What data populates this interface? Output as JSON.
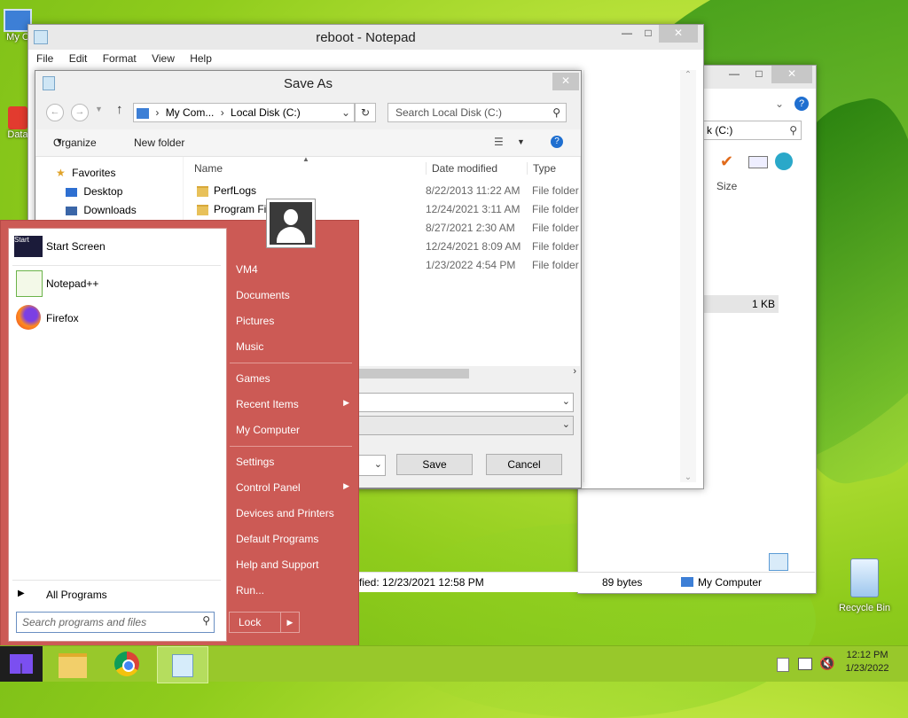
{
  "desktop": {
    "icons": [
      {
        "label": "My C",
        "icon": "computer-icon"
      },
      {
        "label": "Data",
        "icon": "shortcut-icon"
      },
      {
        "label": "Recycle Bin",
        "icon": "recycle-bin-icon"
      }
    ]
  },
  "notepad": {
    "title": "reboot - Notepad",
    "menu": [
      "File",
      "Edit",
      "Format",
      "View",
      "Help"
    ]
  },
  "explorer_bg": {
    "address_tail": "k (C:)",
    "col_size": "Size",
    "size_value": "1 KB",
    "status_modified": "fied: 12/23/2021 12:58 PM",
    "status_size": "89 bytes",
    "status_location": "My Computer"
  },
  "save_as": {
    "title": "Save As",
    "address": {
      "part1": "My Com...",
      "part2": "Local Disk (C:)"
    },
    "search_placeholder": "Search Local Disk (C:)",
    "organize": "Organize",
    "new_folder": "New folder",
    "columns": {
      "name": "Name",
      "date": "Date modified",
      "type": "Type"
    },
    "nav": {
      "favorites": "Favorites",
      "desktop": "Desktop",
      "downloads": "Downloads"
    },
    "rows": [
      {
        "name": "PerfLogs",
        "date": "8/22/2013 11:22 AM",
        "type": "File folder"
      },
      {
        "name": "Program Fil",
        "date": "12/24/2021 3:11 AM",
        "type": "File folder"
      },
      {
        "name": "",
        "date": "8/27/2021 2:30 AM",
        "type": "File folder"
      },
      {
        "name": "",
        "date": "12/24/2021 8:09 AM",
        "type": "File folder"
      },
      {
        "name": "",
        "date": "1/23/2022 4:54 PM",
        "type": "File folder"
      }
    ],
    "save": "Save",
    "cancel": "Cancel"
  },
  "start_menu": {
    "pinned": [
      {
        "label": "Start Screen",
        "icon": "start-screen-icon"
      },
      {
        "label": "Notepad++",
        "icon": "notepadpp-icon"
      },
      {
        "label": "Firefox",
        "icon": "firefox-icon"
      }
    ],
    "all_programs": "All Programs",
    "search_placeholder": "Search programs and files",
    "right": {
      "user": "VM4",
      "documents": "Documents",
      "pictures": "Pictures",
      "music": "Music",
      "games": "Games",
      "recent": "Recent Items",
      "computer": "My Computer",
      "settings": "Settings",
      "control_panel": "Control Panel",
      "devices": "Devices and Printers",
      "default_programs": "Default Programs",
      "help": "Help and Support",
      "run": "Run..."
    },
    "lock": "Lock",
    "start_tile": "Start"
  },
  "taskbar": {
    "time": "12:12 PM",
    "date": "1/23/2022"
  },
  "colors": {
    "start_menu": "#cc5a55",
    "taskbar": "#98c82b"
  }
}
